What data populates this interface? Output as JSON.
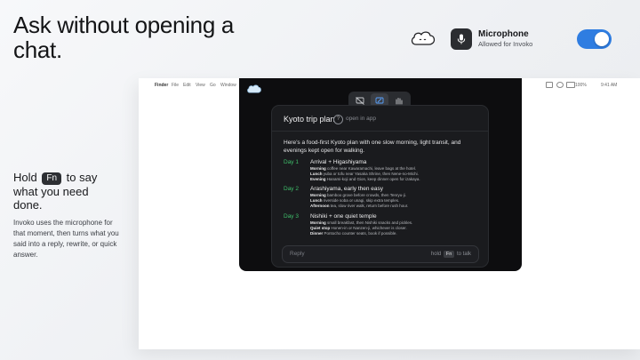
{
  "headline": "Ask without opening a chat.",
  "permission": {
    "title": "Microphone",
    "subtitle": "Allowed for Invoko",
    "enabled": true,
    "icon": "mic-icon",
    "logo_icon": "cloud-logo-icon"
  },
  "instruction": {
    "pre": "Hold",
    "key": "Fn",
    "post": "to say what you need done.",
    "description": "Invoko uses the microphone for that moment, then turns what you said into a reply, rewrite, or quick answer."
  },
  "menubar": {
    "app": "Finder",
    "items": [
      "File",
      "Edit",
      "View",
      "Go",
      "Window"
    ],
    "battery": "100%",
    "clock": "9:41 AM"
  },
  "segmented": {
    "icons": [
      "screen-off-icon",
      "edit-screen-icon",
      "hand-gesture-icon"
    ],
    "active_index": 1
  },
  "card": {
    "title": "Kyoto trip plan",
    "help_glyph": "?",
    "open_label": "open in app",
    "intro": "Here’s a food-first Kyoto plan with one slow morning, light transit, and evenings kept open for walking.",
    "days": [
      {
        "label": "Day 1",
        "title": "Arrival + Higashiyama",
        "lines": [
          {
            "k": "Morning",
            "v": "coffee near Kawaramachi, leave bags at the hotel."
          },
          {
            "k": "Lunch",
            "v": "yuba or tofu near Yasaka Shrine, then Nene-no-Michi."
          },
          {
            "k": "Evening",
            "v": "Hanami-koji and Gion, keep dinner open for izakaya."
          }
        ]
      },
      {
        "label": "Day 2",
        "title": "Arashiyama, early then easy",
        "lines": [
          {
            "k": "Morning",
            "v": "bamboo grove before crowds, then Tenryu-ji."
          },
          {
            "k": "Lunch",
            "v": "riverside soba or unagi, skip extra temples."
          },
          {
            "k": "Afternoon",
            "v": "tea, slow river walk, return before rush hour."
          }
        ]
      },
      {
        "label": "Day 3",
        "title": "Nishiki + one quiet temple",
        "lines": [
          {
            "k": "Morning",
            "v": "small breakfast, then Nishiki snacks and pickles."
          },
          {
            "k": "Quiet stop",
            "v": "Honen-in or Nanzen-ji, whichever is closer."
          },
          {
            "k": "Dinner",
            "v": "Pontocho counter seats, book if possible."
          }
        ]
      }
    ],
    "reply_placeholder": "Reply",
    "hint_pre": "hold",
    "hint_key": "Fn",
    "hint_post": "to talk"
  },
  "colors": {
    "accent": "#2f7de1",
    "day_label": "#3fbf6a",
    "overlay_bg": "#0d0d0f"
  }
}
